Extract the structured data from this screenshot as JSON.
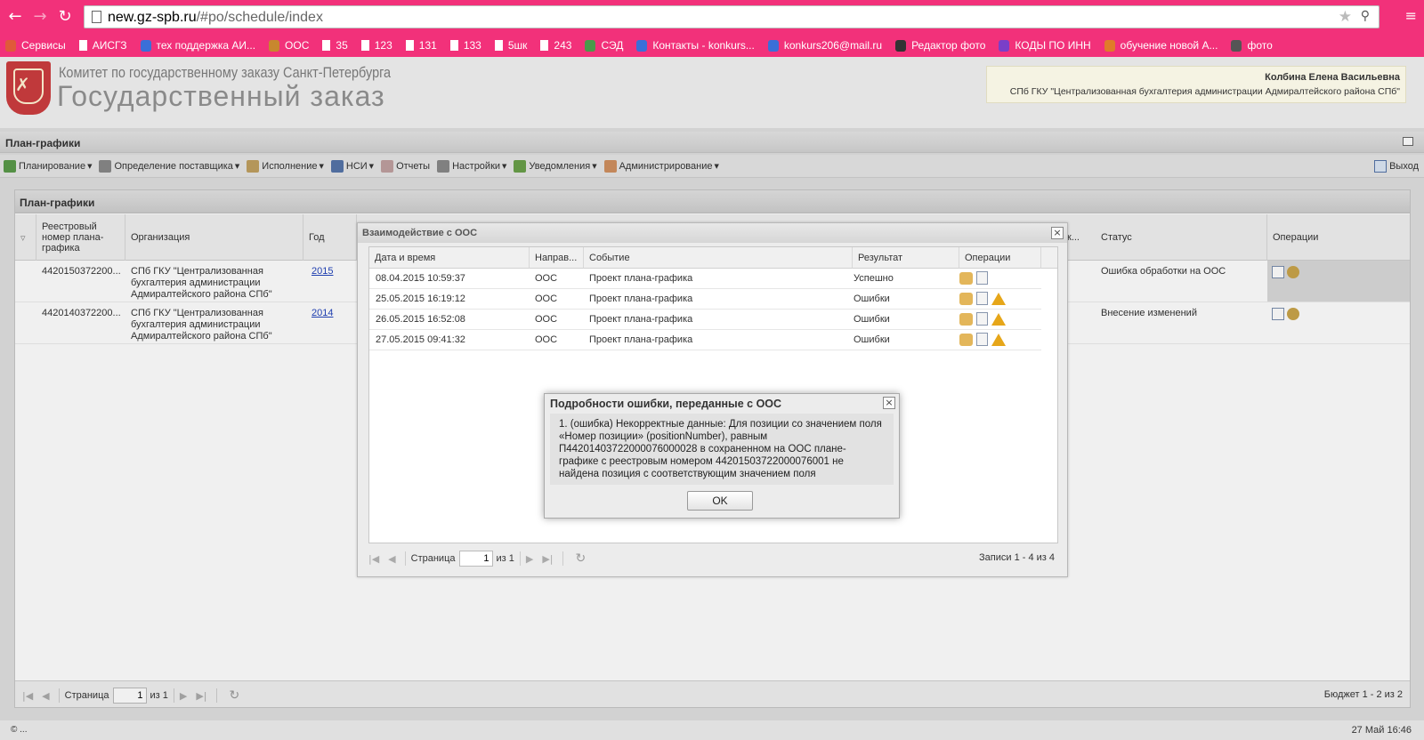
{
  "browser": {
    "url_host": "new.gz-spb.ru",
    "url_path": "/#po/schedule/index",
    "bookmarks": [
      {
        "label": "Сервисы",
        "icon": "apps-icon",
        "color": "#e05a3a"
      },
      {
        "label": "АИСГЗ",
        "icon": "page-icon"
      },
      {
        "label": "тех поддержка АИ...",
        "icon": "help-icon",
        "color": "#3a6fd8"
      },
      {
        "label": "ООС",
        "icon": "emblem-icon",
        "color": "#c8872e"
      },
      {
        "label": "35",
        "icon": "page-icon"
      },
      {
        "label": "123",
        "icon": "page-icon"
      },
      {
        "label": "131",
        "icon": "page-icon"
      },
      {
        "label": "133",
        "icon": "page-icon"
      },
      {
        "label": "5шк",
        "icon": "page-icon"
      },
      {
        "label": "243",
        "icon": "page-icon"
      },
      {
        "label": "СЭД",
        "icon": "sed-icon",
        "color": "#4a9a4a"
      },
      {
        "label": "Контакты - konkurs...",
        "icon": "at-icon",
        "color": "#3a6fd8"
      },
      {
        "label": "konkurs206@mail.ru",
        "icon": "at-icon",
        "color": "#3a6fd8"
      },
      {
        "label": "Редактор фото",
        "icon": "photo-editor-icon",
        "color": "#333"
      },
      {
        "label": "КОДЫ ПО ИНН",
        "icon": "codes-icon",
        "color": "#7a3fc8"
      },
      {
        "label": "обучение новой А...",
        "icon": "training-icon",
        "color": "#e07b2a"
      },
      {
        "label": "фото",
        "icon": "brush-icon",
        "color": "#555"
      }
    ]
  },
  "header": {
    "committee": "Комитет по государственному заказу Санкт-Петербурга",
    "title": "Государственный заказ",
    "user_name": "Колбина Елена Васильевна",
    "user_org": "СПб ГКУ \"Централизованная бухгалтерия администрации Адмиралтейского района СПб\""
  },
  "section_title": "План-графики",
  "toolbar": {
    "items": [
      {
        "label": "Планирование",
        "icon": "planning-icon",
        "color": "#5a9a4a"
      },
      {
        "label": "Определение поставщика",
        "icon": "supplier-icon",
        "color": "#888"
      },
      {
        "label": "Исполнение",
        "icon": "execution-icon",
        "color": "#c0a060"
      },
      {
        "label": "НСИ",
        "icon": "book-icon",
        "color": "#5574a8"
      },
      {
        "label": "Отчеты",
        "icon": "report-icon",
        "color": "#c0a0a0"
      },
      {
        "label": "Настройки",
        "icon": "wrench-icon",
        "color": "#888"
      },
      {
        "label": "Уведомления",
        "icon": "notifications-icon",
        "color": "#6aa04a"
      },
      {
        "label": "Администрирование",
        "icon": "admin-icon",
        "color": "#d09060"
      }
    ],
    "exit": "Выход"
  },
  "main": {
    "title": "План-графики",
    "columns": {
      "reg": "Реестровый номер плана-графика",
      "org": "Организация",
      "year": "Год",
      "trunc": "к...",
      "status": "Статус",
      "ops": "Операции"
    },
    "rows": [
      {
        "reg": "4420150372200...",
        "org": "СПб ГКУ \"Централизованная бухгалтерия администрации Адмиралтейского района СПб\"",
        "year": "2015",
        "status": "Ошибка обработки на ООС"
      },
      {
        "reg": "4420140372200...",
        "org": "СПб ГКУ \"Централизованная бухгалтерия администрации Адмиралтейского района СПб\"",
        "year": "2014",
        "status": "Внесение изменений"
      }
    ],
    "pager": {
      "page_label": "Страница",
      "page": "1",
      "of_label": "из 1",
      "summary": "Бюджет 1 - 2 из 2"
    }
  },
  "oos_window": {
    "title": "Взаимодействие с ООС",
    "columns": {
      "datetime": "Дата и время",
      "direction": "Направ...",
      "event": "Событие",
      "result": "Результат",
      "ops": "Операции"
    },
    "rows": [
      {
        "datetime": "08.04.2015 10:59:37",
        "direction": "ООС",
        "event": "Проект плана-графика",
        "result": "Успешно",
        "warn": false
      },
      {
        "datetime": "25.05.2015 16:19:12",
        "direction": "ООС",
        "event": "Проект плана-графика",
        "result": "Ошибки",
        "warn": true
      },
      {
        "datetime": "26.05.2015 16:52:08",
        "direction": "ООС",
        "event": "Проект плана-графика",
        "result": "Ошибки",
        "warn": true
      },
      {
        "datetime": "27.05.2015 09:41:32",
        "direction": "ООС",
        "event": "Проект плана-графика",
        "result": "Ошибки",
        "warn": true
      }
    ],
    "pager": {
      "page_label": "Страница",
      "page": "1",
      "of_label": "из 1",
      "summary": "Записи 1 - 4 из 4"
    }
  },
  "error_dialog": {
    "title": "Подробности ошибки, переданные с ООС",
    "message": "1. (ошибка) Некорректные данные: Для позиции со значением поля «Номер позиции» (positionNumber), равным П44201403722000076000028 в сохраненном на ООС плане-графике с реестровым номером 44201503722000076001 не найдена позиция с соответствующим значением поля",
    "ok": "OK"
  },
  "status_bar": {
    "left": "© ...",
    "right": "27 Май 16:46"
  }
}
